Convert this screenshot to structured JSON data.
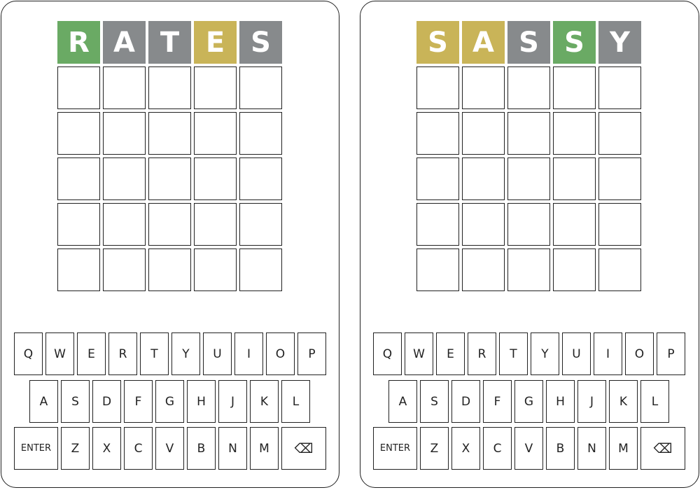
{
  "games": [
    {
      "answer_guess_rows": [
        [
          {
            "letter": "R",
            "state": "green"
          },
          {
            "letter": "A",
            "state": "gray"
          },
          {
            "letter": "T",
            "state": "gray"
          },
          {
            "letter": "E",
            "state": "yellow"
          },
          {
            "letter": "S",
            "state": "gray"
          }
        ],
        [
          {
            "letter": "",
            "state": "empty"
          },
          {
            "letter": "",
            "state": "empty"
          },
          {
            "letter": "",
            "state": "empty"
          },
          {
            "letter": "",
            "state": "empty"
          },
          {
            "letter": "",
            "state": "empty"
          }
        ],
        [
          {
            "letter": "",
            "state": "empty"
          },
          {
            "letter": "",
            "state": "empty"
          },
          {
            "letter": "",
            "state": "empty"
          },
          {
            "letter": "",
            "state": "empty"
          },
          {
            "letter": "",
            "state": "empty"
          }
        ],
        [
          {
            "letter": "",
            "state": "empty"
          },
          {
            "letter": "",
            "state": "empty"
          },
          {
            "letter": "",
            "state": "empty"
          },
          {
            "letter": "",
            "state": "empty"
          },
          {
            "letter": "",
            "state": "empty"
          }
        ],
        [
          {
            "letter": "",
            "state": "empty"
          },
          {
            "letter": "",
            "state": "empty"
          },
          {
            "letter": "",
            "state": "empty"
          },
          {
            "letter": "",
            "state": "empty"
          },
          {
            "letter": "",
            "state": "empty"
          }
        ],
        [
          {
            "letter": "",
            "state": "empty"
          },
          {
            "letter": "",
            "state": "empty"
          },
          {
            "letter": "",
            "state": "empty"
          },
          {
            "letter": "",
            "state": "empty"
          },
          {
            "letter": "",
            "state": "empty"
          }
        ]
      ]
    },
    {
      "answer_guess_rows": [
        [
          {
            "letter": "S",
            "state": "yellow"
          },
          {
            "letter": "A",
            "state": "yellow"
          },
          {
            "letter": "S",
            "state": "gray"
          },
          {
            "letter": "S",
            "state": "green"
          },
          {
            "letter": "Y",
            "state": "gray"
          }
        ],
        [
          {
            "letter": "",
            "state": "empty"
          },
          {
            "letter": "",
            "state": "empty"
          },
          {
            "letter": "",
            "state": "empty"
          },
          {
            "letter": "",
            "state": "empty"
          },
          {
            "letter": "",
            "state": "empty"
          }
        ],
        [
          {
            "letter": "",
            "state": "empty"
          },
          {
            "letter": "",
            "state": "empty"
          },
          {
            "letter": "",
            "state": "empty"
          },
          {
            "letter": "",
            "state": "empty"
          },
          {
            "letter": "",
            "state": "empty"
          }
        ],
        [
          {
            "letter": "",
            "state": "empty"
          },
          {
            "letter": "",
            "state": "empty"
          },
          {
            "letter": "",
            "state": "empty"
          },
          {
            "letter": "",
            "state": "empty"
          },
          {
            "letter": "",
            "state": "empty"
          }
        ],
        [
          {
            "letter": "",
            "state": "empty"
          },
          {
            "letter": "",
            "state": "empty"
          },
          {
            "letter": "",
            "state": "empty"
          },
          {
            "letter": "",
            "state": "empty"
          },
          {
            "letter": "",
            "state": "empty"
          }
        ],
        [
          {
            "letter": "",
            "state": "empty"
          },
          {
            "letter": "",
            "state": "empty"
          },
          {
            "letter": "",
            "state": "empty"
          },
          {
            "letter": "",
            "state": "empty"
          },
          {
            "letter": "",
            "state": "empty"
          }
        ]
      ]
    }
  ],
  "keyboard": {
    "row1": [
      "Q",
      "W",
      "E",
      "R",
      "T",
      "Y",
      "U",
      "I",
      "O",
      "P"
    ],
    "row2": [
      "A",
      "S",
      "D",
      "F",
      "G",
      "H",
      "J",
      "K",
      "L"
    ],
    "row3": [
      "ENTER",
      "Z",
      "X",
      "C",
      "V",
      "B",
      "N",
      "M",
      "⌫"
    ],
    "enter_label": "ENTER",
    "backspace_label": "⌫"
  },
  "colors": {
    "green": "#6aaa64",
    "yellow": "#c9b458",
    "gray": "#878a8c",
    "border": "#222222"
  }
}
